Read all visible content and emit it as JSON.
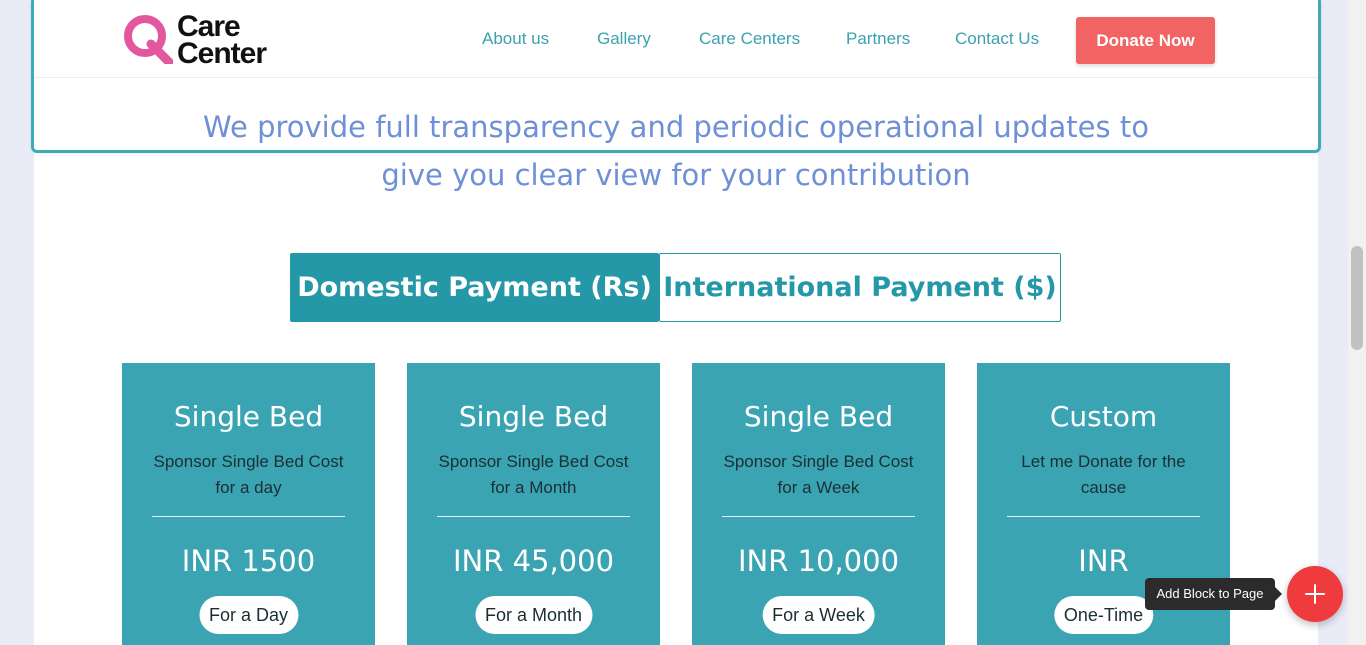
{
  "header": {
    "logo": {
      "line1": "Care",
      "line2": "Center",
      "q_color": "#e3579e"
    },
    "nav": [
      "About us",
      "Gallery",
      "Care Centers",
      "Partners",
      "Contact Us"
    ],
    "donate_label": "Donate Now"
  },
  "tagline": {
    "line1": "We provide full transparency and periodic operational updates to",
    "line2": "give you clear view for your contribution"
  },
  "tabs": {
    "domestic": "Domestic Payment (Rs)",
    "international": "International Payment ($)"
  },
  "cards": [
    {
      "title": "Single Bed",
      "desc": "Sponsor Single Bed Cost for a day",
      "price": "INR 1500",
      "period": "For a Day"
    },
    {
      "title": "Single Bed",
      "desc": "Sponsor Single Bed Cost for a Month",
      "price": "INR 45,000",
      "period": "For a Month"
    },
    {
      "title": "Single Bed",
      "desc": "Sponsor Single Bed Cost for a Week",
      "price": "INR 10,000",
      "period": "For a Week"
    },
    {
      "title": "Custom",
      "desc": "Let me Donate for the cause",
      "price": "INR",
      "period": "One-Time"
    }
  ],
  "editor": {
    "tooltip": "Add Block to Page",
    "add_icon": "plus-icon"
  },
  "colors": {
    "accent": "#2598a8",
    "card_bg": "#3aa4b3",
    "donate": "#f26364",
    "tagline": "#6e90d6",
    "add_button": "#f03b3e"
  }
}
